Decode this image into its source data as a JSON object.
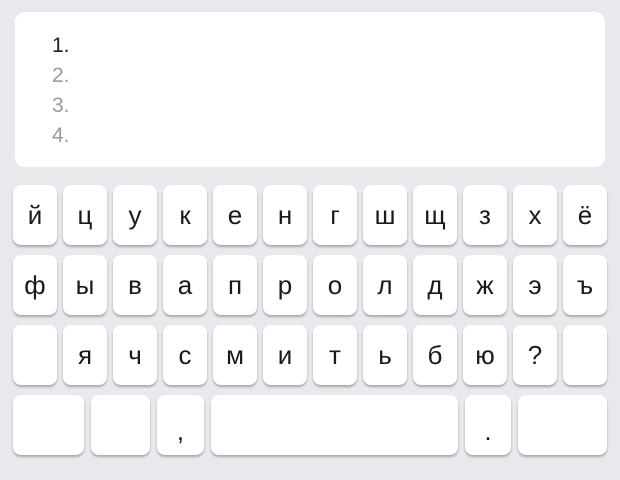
{
  "text_area": {
    "lines": [
      "1.",
      "2.",
      "3.",
      "4."
    ]
  },
  "keyboard": {
    "row1": [
      "й",
      "ц",
      "у",
      "к",
      "е",
      "н",
      "г",
      "ш",
      "щ",
      "з",
      "х",
      "ё"
    ],
    "row2": [
      "ф",
      "ы",
      "в",
      "а",
      "п",
      "р",
      "о",
      "л",
      "д",
      "ж",
      "э",
      "ъ"
    ],
    "row3": [
      "",
      "я",
      "ч",
      "с",
      "м",
      "и",
      "т",
      "ь",
      "б",
      "ю",
      "?",
      ""
    ],
    "row4": [
      "",
      "",
      ",",
      "",
      ".",
      ""
    ]
  },
  "colors": {
    "background": "#e8e9ec",
    "key": "#ffffff",
    "key_text": "#1a1a1a",
    "placeholder_text": "#9b9b9b"
  }
}
